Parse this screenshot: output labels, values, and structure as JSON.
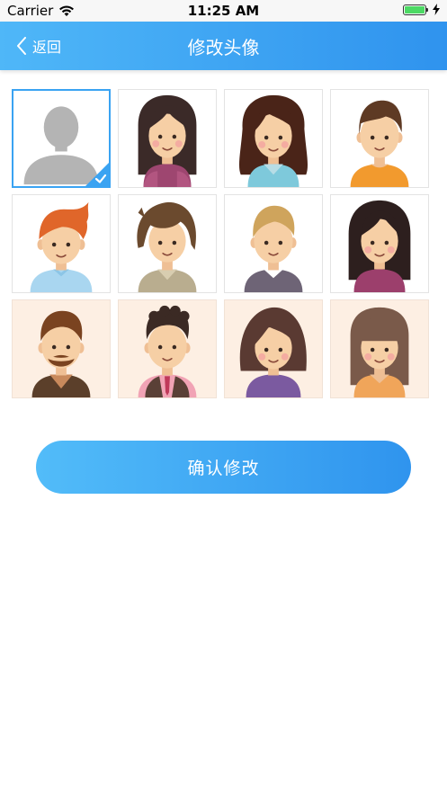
{
  "status_bar": {
    "carrier": "Carrier",
    "time": "11:25 AM",
    "battery_level": 1.0
  },
  "nav": {
    "back_label": "返回",
    "title": "修改头像"
  },
  "avatars": [
    {
      "id": "placeholder",
      "background": "white",
      "selected": true
    },
    {
      "id": "girl-long-black-hair",
      "background": "white",
      "selected": false
    },
    {
      "id": "girl-brown-hair-hoodie",
      "background": "white",
      "selected": false
    },
    {
      "id": "boy-brown-hair-orange-shirt",
      "background": "white",
      "selected": false
    },
    {
      "id": "boy-orange-hair-blue-shirt",
      "background": "white",
      "selected": false
    },
    {
      "id": "boy-shaggy-hair",
      "background": "white",
      "selected": false
    },
    {
      "id": "boy-blond-hair",
      "background": "white",
      "selected": false
    },
    {
      "id": "girl-long-hair-purple",
      "background": "white",
      "selected": false
    },
    {
      "id": "man-beard",
      "background": "peach",
      "selected": false
    },
    {
      "id": "man-vest-tie",
      "background": "peach",
      "selected": false
    },
    {
      "id": "girl-bob-hair",
      "background": "peach",
      "selected": false
    },
    {
      "id": "girl-bangs-hair",
      "background": "peach",
      "selected": false
    }
  ],
  "confirm_button": {
    "label": "确认修改"
  },
  "colors": {
    "accent_start": "#4fb7f8",
    "accent_end": "#2f93ee",
    "selected_border": "#3aa3f2",
    "battery": "#4cd964"
  }
}
